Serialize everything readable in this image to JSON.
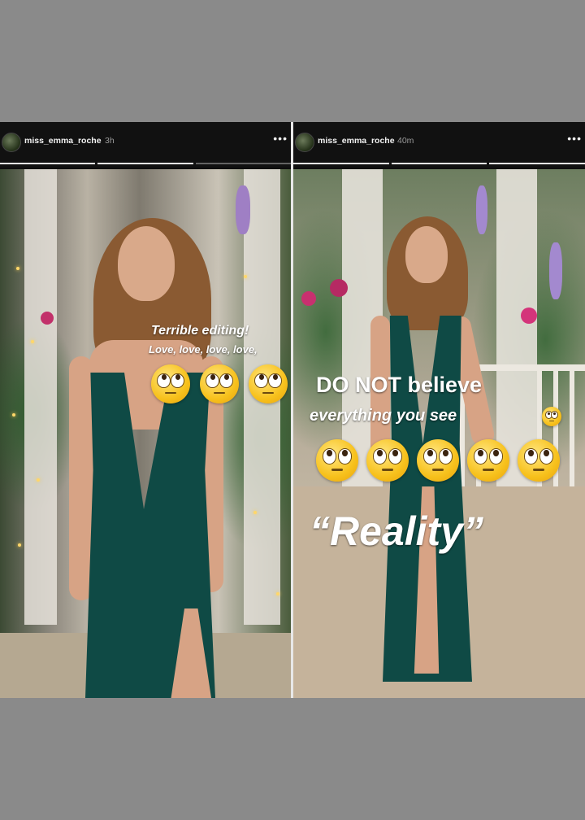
{
  "left_story": {
    "username": "miss_emma_roche",
    "timestamp": "3h",
    "more_label": "•••",
    "caption_line1": "Terrible editing!",
    "caption_line2": "Love, love, love, love,",
    "emoji_count": 3,
    "emoji_name": "face-with-rolling-eyes-icon"
  },
  "right_story": {
    "username": "miss_emma_roche",
    "timestamp": "40m",
    "more_label": "•••",
    "caption_line1": "DO NOT believe",
    "caption_line2": "everything you see",
    "caption_line3": "“Reality”",
    "emoji_count": 5,
    "emoji_name": "face-with-rolling-eyes-icon"
  },
  "colors": {
    "page_background": "#8a8a8a",
    "header_background": "#111111",
    "dress": "#0f4a45",
    "overlay_text": "#ffffff",
    "emoji_yellow": "#f7c11c"
  }
}
